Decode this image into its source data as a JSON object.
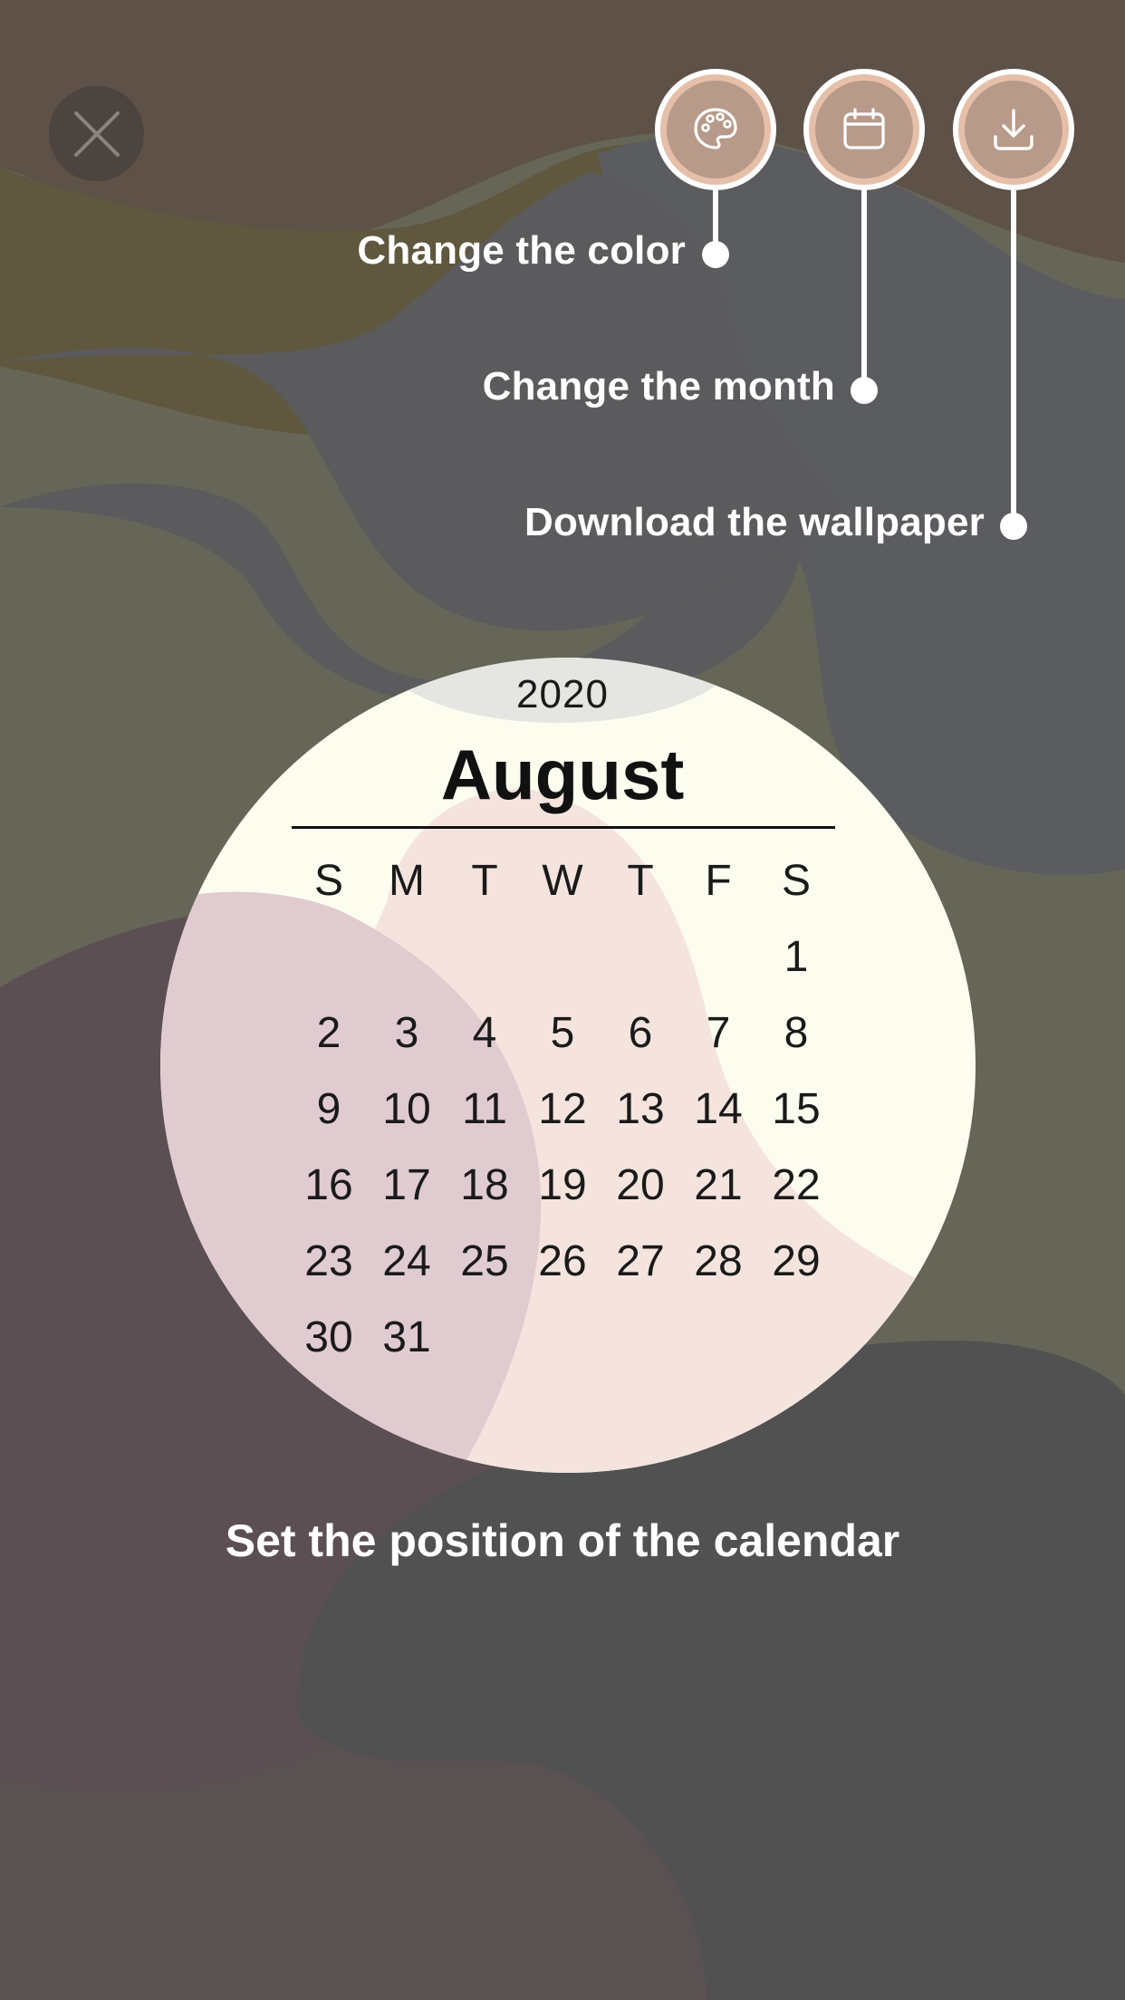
{
  "toolbar": {
    "close_icon": "close-icon",
    "buttons": [
      {
        "id": "color",
        "icon": "palette-icon",
        "label": "Change the color"
      },
      {
        "id": "month",
        "icon": "calendar-icon",
        "label": "Change the month"
      },
      {
        "id": "download",
        "icon": "download-icon",
        "label": "Download the wallpaper"
      }
    ]
  },
  "calendar": {
    "year": "2020",
    "month": "August",
    "weekdays": [
      "S",
      "M",
      "T",
      "W",
      "T",
      "F",
      "S"
    ],
    "first_weekday_index": 6,
    "days_in_month": 31
  },
  "hint": {
    "position_label": "Set the position of the calendar"
  },
  "colors": {
    "button_ring": "#ffffff",
    "button_fill": "#e6bfa9",
    "calendar_base": "#fcfdee",
    "calendar_blob_peach": "#f5e4de",
    "calendar_blob_mauve": "#e0cbd0",
    "year_bubble": "#e5e5e2"
  }
}
